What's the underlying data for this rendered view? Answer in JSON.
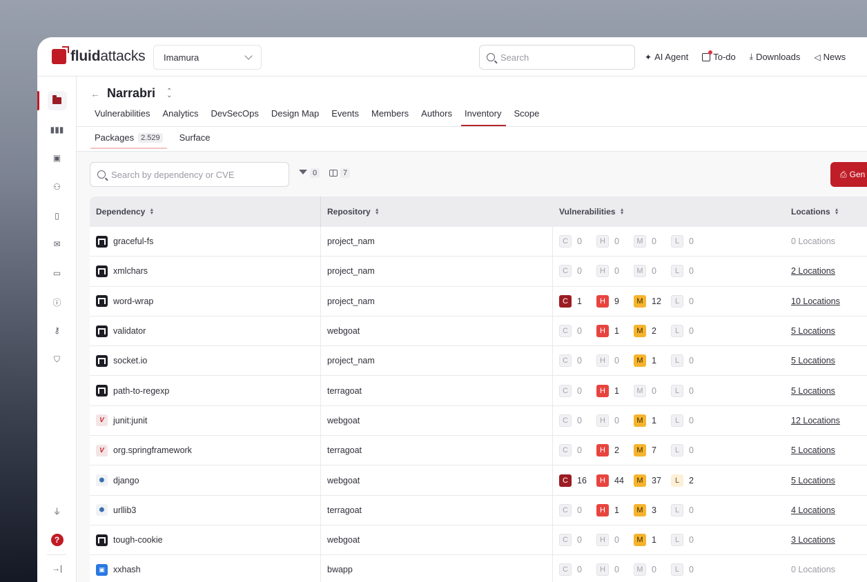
{
  "brand": {
    "name_bold": "fluid",
    "name_rest": "attacks"
  },
  "org_selector": {
    "value": "Imamura"
  },
  "top_search": {
    "placeholder": "Search"
  },
  "top_actions": {
    "ai_agent": "AI Agent",
    "todo": "To-do",
    "downloads": "Downloads",
    "news": "News"
  },
  "sidebar": {
    "items": [
      {
        "name": "groups",
        "icon": "folder-icon"
      },
      {
        "name": "analytics",
        "icon": "bar-chart-icon"
      },
      {
        "name": "portfolio",
        "icon": "briefcase-icon"
      },
      {
        "name": "members",
        "icon": "user-plus-icon"
      },
      {
        "name": "documents",
        "icon": "file-search-icon"
      },
      {
        "name": "inbox",
        "icon": "mail-icon"
      },
      {
        "name": "billing",
        "icon": "credit-card-icon"
      },
      {
        "name": "alerts",
        "icon": "alert-circle-icon"
      },
      {
        "name": "credentials",
        "icon": "key-icon"
      },
      {
        "name": "policies",
        "icon": "shield-icon"
      }
    ],
    "bottom": [
      "plug-icon",
      "help-icon",
      "collapse-icon"
    ],
    "help_label": "?"
  },
  "header": {
    "group_name": "Narrabri",
    "tabs": [
      "Vulnerabilities",
      "Analytics",
      "DevSecOps",
      "Design Map",
      "Events",
      "Members",
      "Authors",
      "Inventory",
      "Scope"
    ],
    "active_tab": "Inventory",
    "subtabs": [
      {
        "label": "Packages",
        "count": "2.529"
      },
      {
        "label": "Surface"
      }
    ]
  },
  "toolbar": {
    "search_placeholder": "Search by dependency or CVE",
    "filters_count": "0",
    "columns_count": "7",
    "generate_label": "Gen"
  },
  "table": {
    "columns": [
      "Dependency",
      "Repository",
      "Vulnerabilities",
      "Locations"
    ],
    "severity_letters": [
      "C",
      "H",
      "M",
      "L"
    ],
    "rows": [
      {
        "dependency": "graceful-fs",
        "type": "npm",
        "repository": "project_nam",
        "vulns": [
          0,
          0,
          0,
          0
        ],
        "locations": "0 Locations"
      },
      {
        "dependency": "xmlchars",
        "type": "npm",
        "repository": "project_nam",
        "vulns": [
          0,
          0,
          0,
          0
        ],
        "locations": "2 Locations"
      },
      {
        "dependency": "word-wrap",
        "type": "npm",
        "repository": "project_nam",
        "vulns": [
          1,
          9,
          12,
          0
        ],
        "locations": "10 Locations"
      },
      {
        "dependency": "validator",
        "type": "npm",
        "repository": "webgoat",
        "vulns": [
          0,
          1,
          2,
          0
        ],
        "locations": "5 Locations"
      },
      {
        "dependency": "socket.io",
        "type": "npm",
        "repository": "project_nam",
        "vulns": [
          0,
          0,
          1,
          0
        ],
        "locations": "5 Locations"
      },
      {
        "dependency": "path-to-regexp",
        "type": "npm",
        "repository": "terragoat",
        "vulns": [
          0,
          1,
          0,
          0
        ],
        "locations": "5 Locations"
      },
      {
        "dependency": "junit:junit",
        "type": "maven",
        "repository": "webgoat",
        "vulns": [
          0,
          0,
          1,
          0
        ],
        "locations": "12 Locations"
      },
      {
        "dependency": "org.springframework",
        "type": "maven",
        "repository": "terragoat",
        "vulns": [
          0,
          2,
          7,
          0
        ],
        "locations": "5 Locations"
      },
      {
        "dependency": "django",
        "type": "python",
        "repository": "webgoat",
        "vulns": [
          16,
          44,
          37,
          2
        ],
        "locations": "5 Locations"
      },
      {
        "dependency": "urllib3",
        "type": "python",
        "repository": "terragoat",
        "vulns": [
          0,
          1,
          3,
          0
        ],
        "locations": "4 Locations"
      },
      {
        "dependency": "tough-cookie",
        "type": "npm",
        "repository": "webgoat",
        "vulns": [
          0,
          0,
          1,
          0
        ],
        "locations": "3 Locations"
      },
      {
        "dependency": "xxhash",
        "type": "docker",
        "repository": "bwapp",
        "vulns": [
          0,
          0,
          0,
          0
        ],
        "locations": "0 Locations"
      }
    ]
  },
  "colors": {
    "brand_red": "#c01b25",
    "critical": "#9b1c22",
    "high": "#e8443f",
    "medium": "#f6b42e",
    "low": "#fdf0d7"
  }
}
